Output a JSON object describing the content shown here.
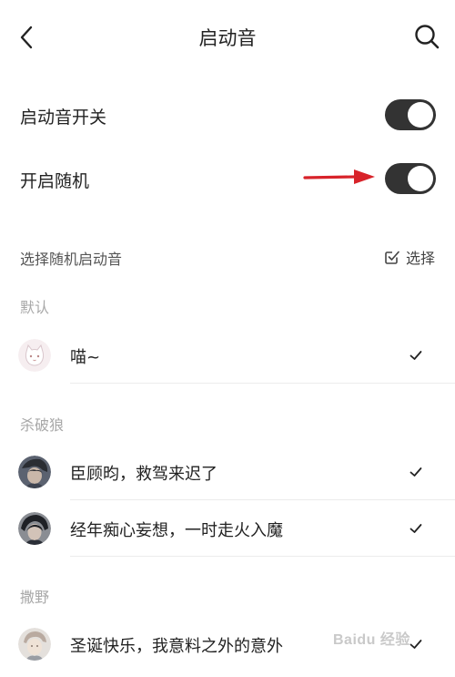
{
  "header": {
    "title": "启动音",
    "back_icon": "chevron-left-icon",
    "search_icon": "search-icon"
  },
  "settings": {
    "startup_sound_switch": {
      "label": "启动音开关",
      "on": true
    },
    "random_switch": {
      "label": "开启随机",
      "on": true
    }
  },
  "random_section": {
    "label": "选择随机启动音",
    "select_label": "选择"
  },
  "groups": [
    {
      "title": "默认",
      "items": [
        {
          "text": "喵~",
          "avatar": "cat-avatar",
          "checked": true
        }
      ]
    },
    {
      "title": "杀破狼",
      "items": [
        {
          "text": "臣顾昀，救驾来迟了",
          "avatar": "character-avatar",
          "checked": true
        },
        {
          "text": "经年痴心妄想，一时走火入魔",
          "avatar": "character-avatar",
          "checked": true
        }
      ]
    },
    {
      "title": "撒野",
      "items": [
        {
          "text": "圣诞快乐，我意料之外的意外",
          "avatar": "character-avatar",
          "checked": true
        }
      ]
    }
  ],
  "watermark": "Baidu 经验",
  "colors": {
    "toggle_on": "#333333",
    "annotation_arrow": "#d8232a",
    "group_title": "#a8a8a8"
  }
}
